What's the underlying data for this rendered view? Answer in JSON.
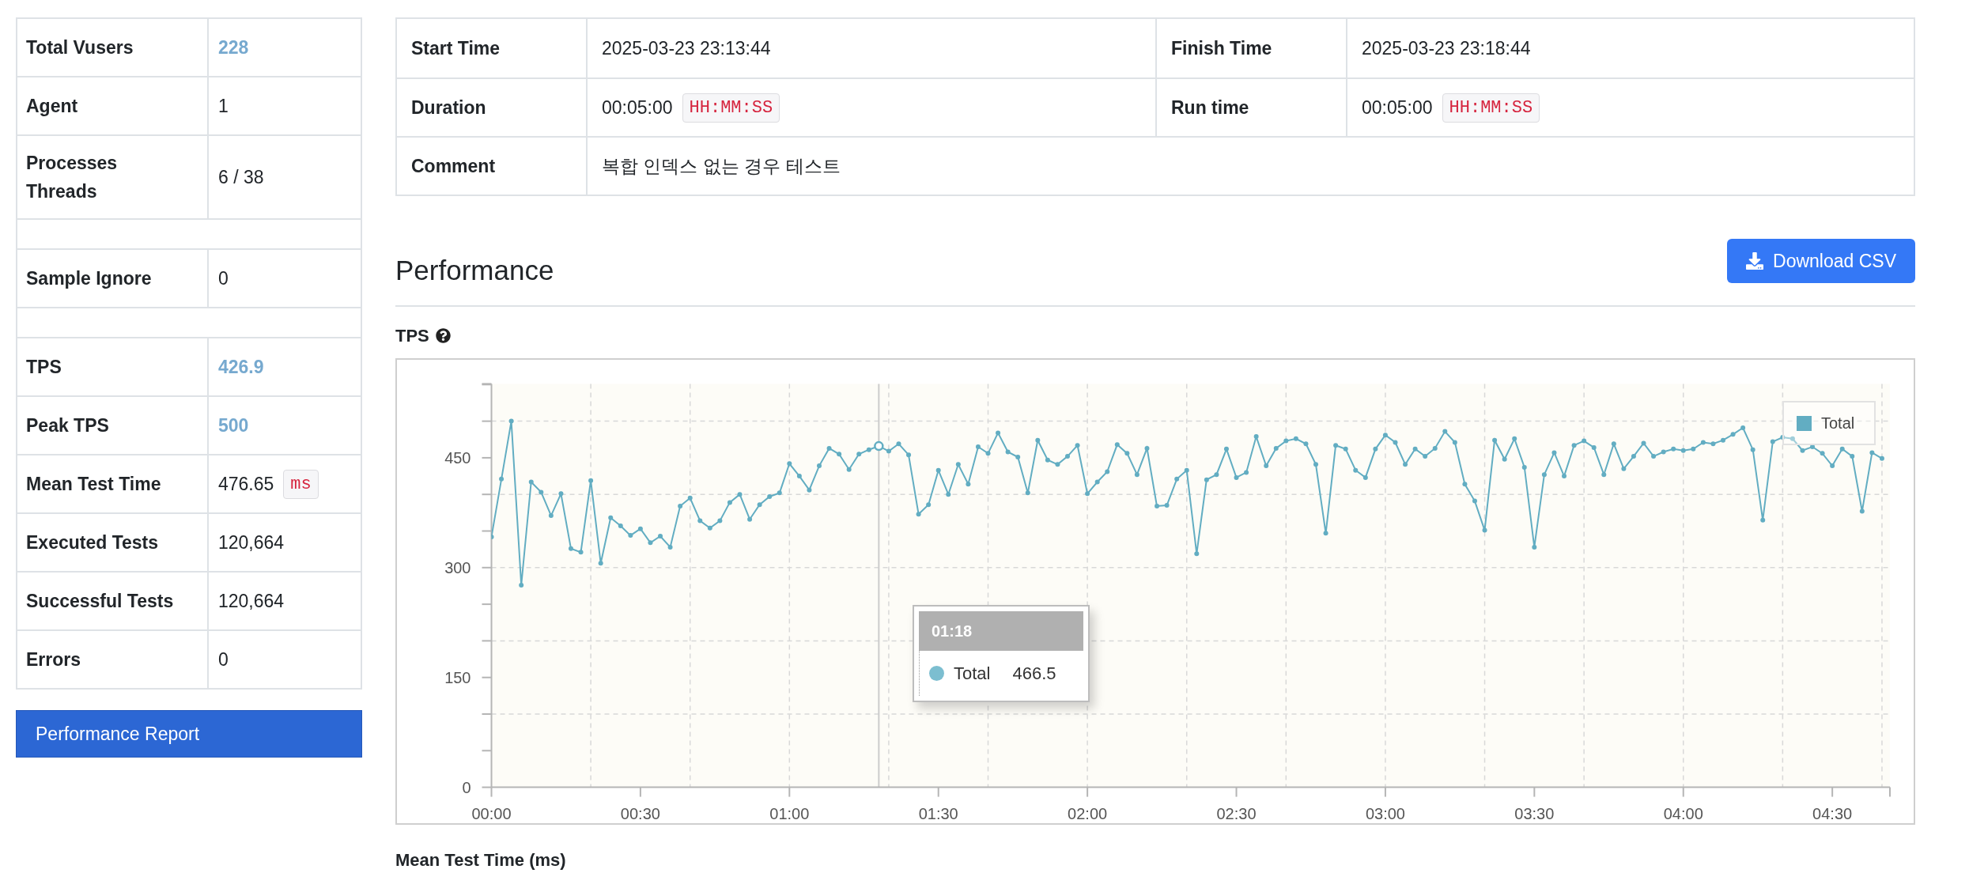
{
  "summary": [
    {
      "kind": "stat",
      "label": "Total Vusers",
      "value": "228",
      "highlight": true
    },
    {
      "kind": "stat",
      "label": "Agent",
      "value": "1",
      "highlight": false
    },
    {
      "kind": "stat",
      "label": "Processes\nThreads",
      "value": "6 / 38",
      "highlight": false
    },
    {
      "kind": "spacer"
    },
    {
      "kind": "stat",
      "label": "Sample Ignore",
      "value": "0",
      "highlight": false
    },
    {
      "kind": "spacer"
    },
    {
      "kind": "stat",
      "label": "TPS",
      "value": "426.9",
      "highlight": true
    },
    {
      "kind": "stat",
      "label": "Peak TPS",
      "value": "500",
      "highlight": true
    },
    {
      "kind": "stat",
      "label": "Mean Test Time",
      "value": "476.65",
      "unit": "ms",
      "highlight": false
    },
    {
      "kind": "stat",
      "label": "Executed Tests",
      "value": "120,664",
      "highlight": false
    },
    {
      "kind": "stat",
      "label": "Successful Tests",
      "value": "120,664",
      "highlight": false
    },
    {
      "kind": "stat",
      "label": "Errors",
      "value": "0",
      "highlight": false
    }
  ],
  "report_button": "Performance Report",
  "run_info": [
    {
      "cells": [
        {
          "label": "Start Time",
          "value": "2025-03-23 23:13:44"
        },
        {
          "label": "Finish Time",
          "value": "2025-03-23 23:18:44"
        }
      ]
    },
    {
      "cells": [
        {
          "label": "Duration",
          "value": "00:05:00",
          "unit": "HH:MM:SS"
        },
        {
          "label": "Run time",
          "value": "00:05:00",
          "unit": "HH:MM:SS"
        }
      ]
    },
    {
      "cells": [
        {
          "label": "Comment",
          "value": "복합 인덱스 없는 경우 테스트"
        }
      ]
    }
  ],
  "performance": {
    "title": "Performance",
    "download_button": "Download CSV",
    "tps": {
      "label": "TPS",
      "tooltip": {
        "title": "01:18",
        "series": "Total",
        "value": "466.5"
      },
      "chart_data": {
        "type": "line",
        "xlim": [
          0,
          281.6
        ],
        "ylim": [
          0,
          551
        ],
        "xticks": [
          {
            "value": 0,
            "label": "00:00"
          },
          {
            "value": 30,
            "label": "00:30"
          },
          {
            "value": 60,
            "label": "01:00"
          },
          {
            "value": 90,
            "label": "01:30"
          },
          {
            "value": 120,
            "label": "02:00"
          },
          {
            "value": 150,
            "label": "02:30"
          },
          {
            "value": 180,
            "label": "03:00"
          },
          {
            "value": 210,
            "label": "03:30"
          },
          {
            "value": 240,
            "label": "04:00"
          },
          {
            "value": 270,
            "label": "04:30"
          }
        ],
        "yticks": [
          0,
          150,
          300,
          450
        ],
        "grid": true,
        "ref_lines": [
          {
            "axis": "x",
            "value": 78,
            "color": "#cccccc"
          }
        ],
        "x": [
          0,
          2,
          4,
          6,
          8,
          10,
          12,
          14,
          16,
          18,
          20,
          22,
          24,
          26,
          28,
          30,
          32,
          34,
          36,
          38,
          40,
          42,
          44,
          46,
          48,
          50,
          52,
          54,
          56,
          58,
          60,
          62,
          64,
          66,
          68,
          70,
          72,
          74,
          76,
          78,
          80,
          82,
          84,
          86,
          88,
          90,
          92,
          94,
          96,
          98,
          100,
          102,
          104,
          106,
          108,
          110,
          112,
          114,
          116,
          118,
          120,
          122,
          124,
          126,
          128,
          130,
          132,
          134,
          136,
          138,
          140,
          142,
          144,
          146,
          148,
          150,
          152,
          154,
          156,
          158,
          160,
          162,
          164,
          166,
          168,
          170,
          172,
          174,
          176,
          178,
          180,
          182,
          184,
          186,
          188,
          190,
          192,
          194,
          196,
          198,
          200,
          202,
          204,
          206,
          208,
          210,
          212,
          214,
          216,
          218,
          220,
          222,
          224,
          226,
          228,
          230,
          232,
          234,
          236,
          238,
          240,
          242,
          244,
          246,
          248,
          250,
          252,
          254,
          256,
          258,
          260,
          262,
          264,
          266,
          268,
          270,
          272,
          274,
          276,
          278,
          280
        ],
        "series": [
          {
            "name": "Total",
            "color": "#62adc2",
            "marker": "circle",
            "values": [
              342,
              421,
              500,
              276,
              417,
              403,
              371,
              401,
              326,
              321,
              419,
              306,
              368,
              357,
              344,
              353,
              334,
              343,
              328,
              384,
              395,
              364,
              354,
              364,
              389,
              400,
              366,
              386,
              397,
              402,
              442,
              425,
              406,
              439,
              463,
              455,
              434,
              455,
              461,
              466,
              459,
              469,
              454,
              373,
              386,
              433,
              400,
              441,
              414,
              465,
              456,
              484,
              458,
              451,
              402,
              474,
              447,
              441,
              452,
              467,
              401,
              417,
              431,
              468,
              456,
              427,
              463,
              384,
              385,
              421,
              433,
              319,
              420,
              427,
              462,
              423,
              430,
              479,
              439,
              463,
              473,
              476,
              469,
              441,
              347,
              467,
              462,
              433,
              423,
              462,
              481,
              471,
              441,
              462,
              452,
              463,
              486,
              471,
              414,
              391,
              351,
              474,
              448,
              476,
              437,
              328,
              427,
              457,
              425,
              467,
              473,
              464,
              427,
              469,
              435,
              452,
              470,
              452,
              458,
              462,
              460,
              462,
              471,
              469,
              474,
              482,
              491,
              461,
              365,
              472,
              478,
              476,
              460,
              465,
              456,
              439,
              462,
              452,
              377,
              457,
              449
            ]
          }
        ]
      }
    },
    "next_chart_label": "Mean Test Time (ms)"
  }
}
